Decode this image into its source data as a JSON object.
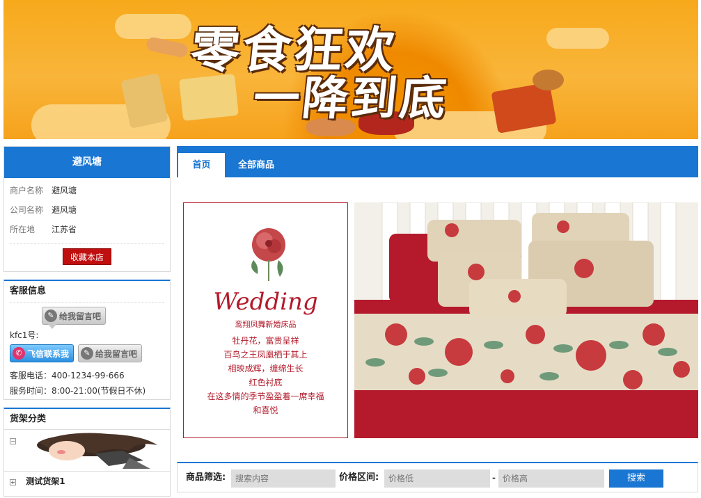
{
  "banner": {
    "line1": "零食狂欢",
    "line2": "一降到底"
  },
  "shop": {
    "header": "避风塘",
    "rows": [
      {
        "key": "商户名称",
        "value": "避风塘"
      },
      {
        "key": "公司名称",
        "value": "避风塘"
      },
      {
        "key": "所在地",
        "value": "江苏省"
      }
    ],
    "fav_button": "收藏本店"
  },
  "customer_service": {
    "title": "客服信息",
    "leave_msg_label": "给我留言吧",
    "kfc_label": "kfc1号:",
    "feixin_label": "飞信联系我",
    "phone": "客服电话：400-1234-99-666",
    "hours": "服务时间：8:00-21:00(节假日不休)"
  },
  "shelf": {
    "title": "货架分类",
    "collapse_glyph": "−",
    "expand_glyph": "+",
    "items": [
      "测试货架1"
    ]
  },
  "tabs": [
    {
      "label": "首页",
      "active": true
    },
    {
      "label": "全部商品",
      "active": false
    }
  ],
  "wedding": {
    "title": "Wedding",
    "subtitle": "鸾翔凤舞新婚床品",
    "poem": [
      "牡丹花，富贵呈祥",
      "百鸟之王凤凰栖于其上",
      "相映成辉，缠绵生长",
      "红色衬底",
      "在这多情的季节盈盈着一席幸福",
      "和喜悦"
    ]
  },
  "filter": {
    "label": "商品筛选:",
    "search_placeholder": "搜索内容",
    "price_label": "价格区间:",
    "low_placeholder": "价格低",
    "dash": "-",
    "high_placeholder": "价格高",
    "button": "搜索"
  },
  "colors": {
    "brand_blue": "#1976d2",
    "fav_red": "#c00f0f",
    "wedding_red": "#b21b2b"
  }
}
